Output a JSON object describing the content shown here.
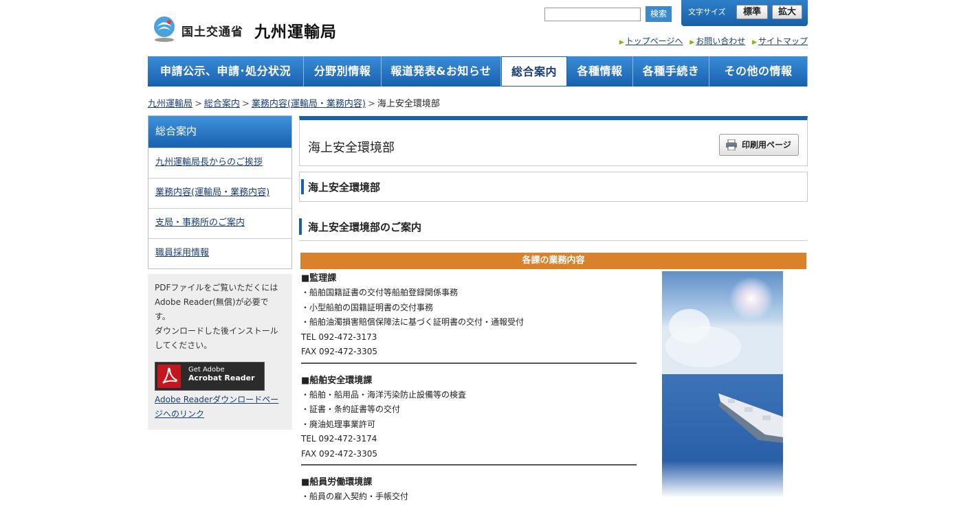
{
  "header": {
    "ministry": "国土交通省",
    "bureau": "九州運輸局",
    "search_button": "検索",
    "fontsize_label": "文字サイズ",
    "fontsize_standard": "標準",
    "fontsize_large": "拡大",
    "util_links": [
      "トップページへ",
      "お問い合わせ",
      "サイトマップ"
    ]
  },
  "nav": {
    "items": [
      "申請公示、申請･処分状況",
      "分野別情報",
      "報道発表&お知らせ",
      "総合案内",
      "各種情報",
      "各種手続き",
      "その他の情報"
    ]
  },
  "breadcrumb": {
    "items": [
      "九州運輸局",
      "総合案内",
      "業務内容(運輸局・業務内容)"
    ],
    "current": "海上安全環境部"
  },
  "sidebar": {
    "title": "総合案内",
    "items": [
      "九州運輸局長からのご挨拶",
      "業務内容(運輸局・業務内容)",
      "支局・事務所のご案内",
      "職員採用情報"
    ],
    "pdf_lines": [
      "PDFファイルをご覧いただくには",
      "Adobe Reader(無償)が必要で",
      "す。",
      "ダウンロードした後インストール",
      "してください。"
    ],
    "adobe_get": "Get Adobe",
    "adobe_product": "Acrobat Reader",
    "pdf_link_text": "Adobe Readerダウンロードページへのリンク"
  },
  "main": {
    "title": "海上安全環境部",
    "print_button": "印刷用ページ",
    "h2": "海上安全環境部",
    "h3": "海上安全環境部のご案内",
    "table_head": "各課の業務内容",
    "sections": [
      {
        "title": "■監理課",
        "lines": [
          "・船舶国籍証書の交付等船舶登録関係事務",
          "・小型船舶の国籍証明書の交付事務",
          "・船舶油濁損害賠償保障法に基づく証明書の交付・通報受付",
          "TEL 092-472-3173",
          "FAX 092-472-3305"
        ]
      },
      {
        "title": "■船舶安全環境課",
        "lines": [
          "・船舶・船用品・海洋汚染防止設備等の検査",
          "・証書・条約証書等の交付",
          "・廃油処理事業許可",
          "TEL 092-472-3174",
          "FAX 092-472-3305"
        ]
      },
      {
        "title": "■船員労働環境課",
        "lines": [
          "・船員の雇入契約・手帳交付"
        ]
      }
    ]
  }
}
